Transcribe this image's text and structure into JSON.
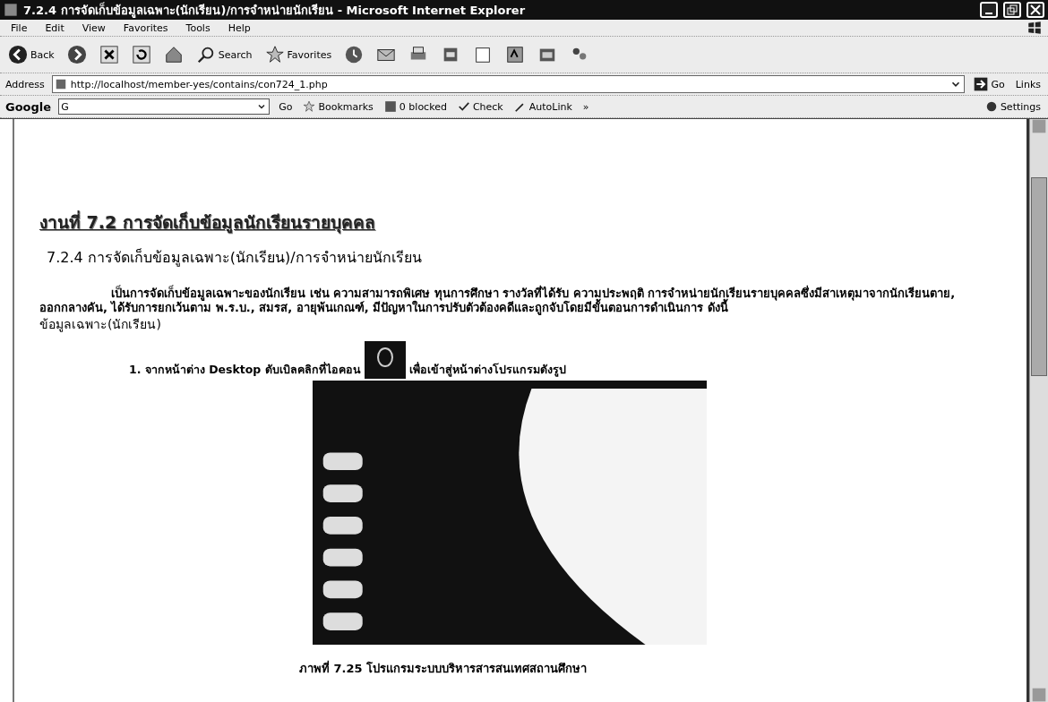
{
  "window": {
    "title": "7.2.4 การจัดเก็บข้อมูลเฉพาะ(นักเรียน)/การจำหน่ายนักเรียน - Microsoft Internet Explorer"
  },
  "menu": [
    "File",
    "Edit",
    "View",
    "Favorites",
    "Tools",
    "Help"
  ],
  "toolbar": [
    {
      "kind": "back",
      "label": "Back"
    },
    {
      "kind": "forward"
    },
    {
      "kind": "stop"
    },
    {
      "kind": "refresh"
    },
    {
      "kind": "home"
    },
    {
      "kind": "search",
      "label": "Search"
    },
    {
      "kind": "favorites",
      "label": "Favorites"
    },
    {
      "kind": "history"
    },
    {
      "kind": "mail"
    },
    {
      "kind": "print"
    },
    {
      "kind": "edit"
    },
    {
      "kind": "blank"
    },
    {
      "kind": "messenger"
    },
    {
      "kind": "media"
    },
    {
      "kind": "people"
    }
  ],
  "address": {
    "label": "Address",
    "value": "http://localhost/member-yes/contains/con724_1.php",
    "go": "Go",
    "links": "Links"
  },
  "google_toolbar": {
    "brand": "Google",
    "field": "G",
    "go": "Go",
    "bookmarks": "Bookmarks",
    "blocked": "0 blocked",
    "check": "Check",
    "autolink": "AutoLink",
    "more": "»",
    "settings": "Settings"
  },
  "page": {
    "banner": "งานที่ 7.2 การจัดเก็บข้อมูลนักเรียนรายบุคคล",
    "heading": "7.2.4 การจัดเก็บข้อมูลเฉพาะ(นักเรียน)/การจำหน่ายนักเรียน",
    "paragraph": "เป็นการจัดเก็บข้อมูลเฉพาะของนักเรียน เช่น ความสามารถพิเศษ ทุนการศึกษา  รางวัลที่ได้รับ ความประพฤติ  การจำหน่ายนักเรียนรายบุคคลซึ่งมีสาเหตุมาจากนักเรียนตาย, ออกกลางคัน, ได้รับการยกเว้นตาม พ.ร.บ., สมรส, อายุพ้นเกณฑ์, มีปัญหาในการปรับตัวต้องคดีและถูกจับโดยมีขั้นตอนการดำเนินการ ดังนี้",
    "subheading": "ข้อมูลเฉพาะ(นักเรียน)",
    "step_before": "1. จากหน้าต่าง Desktop  ดับเบิลคลิกที่ไอคอน",
    "step_after": "เพื่อเข้าสู่หน้าต่างโปรแกรมดังรูป",
    "caption": "ภาพที่ 7.25 โปรแกรมระบบบริหารสารสนเทศสถานศึกษา"
  }
}
